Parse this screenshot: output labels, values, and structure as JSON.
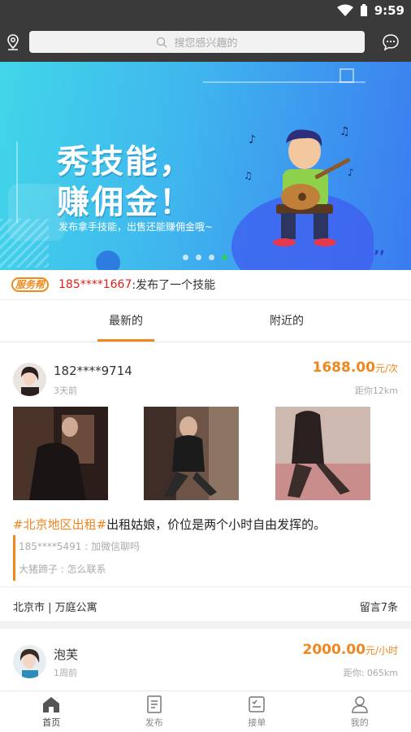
{
  "status_bar": {
    "time": "9:59"
  },
  "search": {
    "placeholder": "搜您感兴趣的"
  },
  "banner": {
    "title_line1": "秀技能，",
    "title_line2": "赚佣金！",
    "subtitle": "发布拿手技能，出售还能赚佣金哦~",
    "slide_count": 4,
    "active_slide": 4,
    "colors": {
      "start": "#41d6e9",
      "end": "#3b7bf0"
    }
  },
  "notice": {
    "logo_text": "服务帮",
    "phone": "185****1667",
    "text": ":发布了一个技能"
  },
  "tabs": [
    {
      "label": "最新的",
      "active": true
    },
    {
      "label": "附近的",
      "active": false
    }
  ],
  "posts": [
    {
      "user": "182****9714",
      "time": "3天前",
      "price": "1688.00",
      "unit": "元/次",
      "distance": "距你12km",
      "tag": "#北京地区出租#",
      "text": "出租姑娘，价位是两个小时自由发挥的。",
      "comments": [
        {
          "text": "185****5491 : 加微信聊吗"
        },
        {
          "text": "大猪蹄子 : 怎么联系"
        }
      ],
      "location": "北京市 | 万庭公寓",
      "comment_count": "留言7条"
    },
    {
      "user": "泡芙",
      "time": "1周前",
      "price": "2000.00",
      "unit": "元/小时",
      "distance": "距你: 065km"
    }
  ],
  "bottom_nav": [
    {
      "label": "首页",
      "icon": "home-icon",
      "active": true
    },
    {
      "label": "发布",
      "icon": "publish-icon",
      "active": false
    },
    {
      "label": "接单",
      "icon": "orders-icon",
      "active": false
    },
    {
      "label": "我的",
      "icon": "profile-icon",
      "active": false
    }
  ],
  "accent_color": "#f0861e"
}
